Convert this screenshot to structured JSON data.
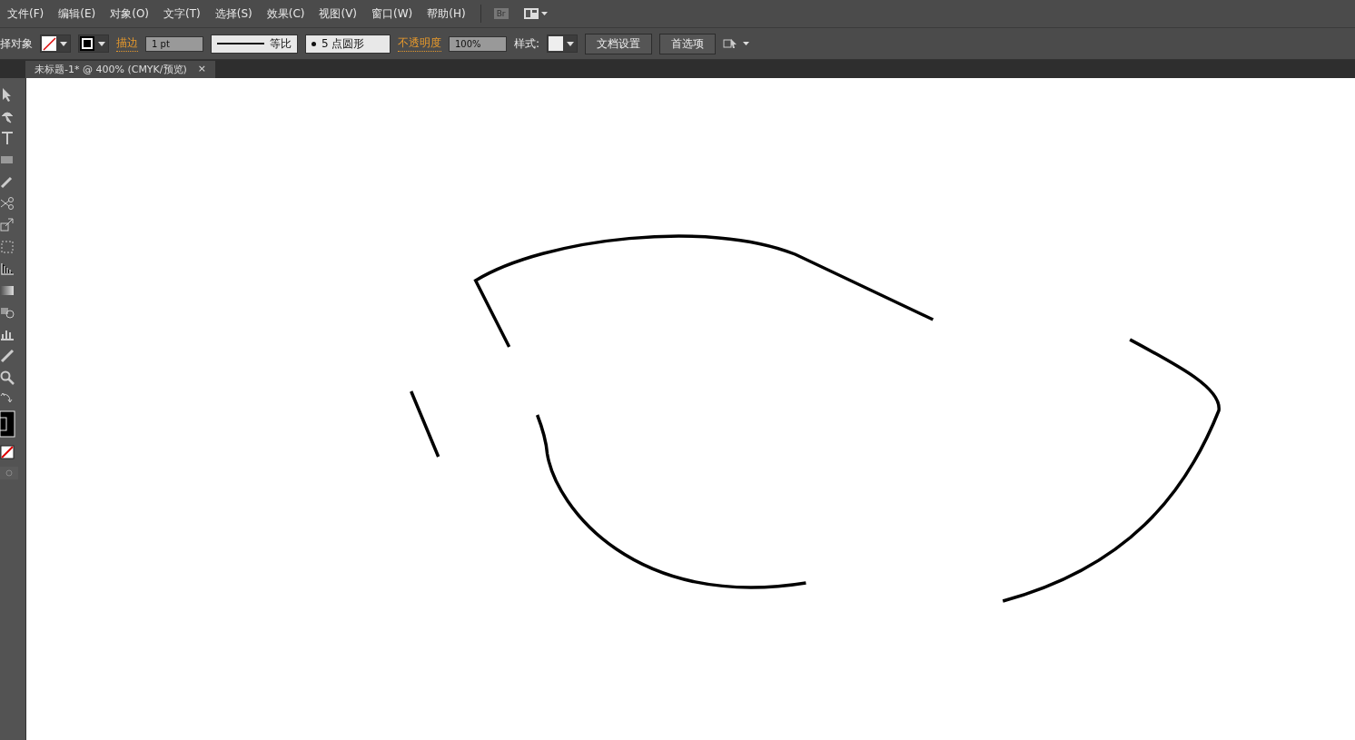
{
  "menu": [
    "文件(F)",
    "编辑(E)",
    "对象(O)",
    "文字(T)",
    "选择(S)",
    "效果(C)",
    "视图(V)",
    "窗口(W)",
    "帮助(H)"
  ],
  "bridge_button": "Br",
  "control_bar": {
    "selection_label": "择对象",
    "stroke_label": "描边",
    "stroke_weight": "1 pt",
    "stroke_profile": "等比",
    "brush": "5 点圆形",
    "opacity_label": "不透明度",
    "opacity": "100%",
    "style_label": "样式:",
    "doc_setup": "文档设置",
    "preferences": "首选项"
  },
  "document_tab": {
    "title": "未标题-1* @ 400% (CMYK/预览)",
    "close": "×"
  }
}
